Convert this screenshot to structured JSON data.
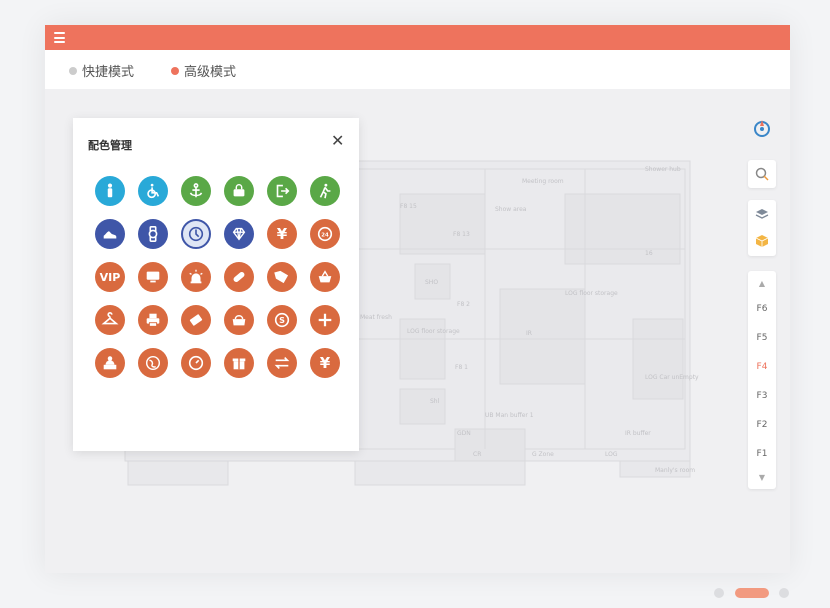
{
  "header": {
    "menu_icon": "menu-icon"
  },
  "modes": [
    {
      "label": "快捷模式",
      "dot_color": "#cccccc"
    },
    {
      "label": "高级模式",
      "dot_color": "#ee735d"
    }
  ],
  "floorplan_labels": [
    "F8 15",
    "F8 13",
    "Show area",
    "Meeting room",
    "Shower hub",
    "SHO",
    "F8 2",
    "LOG floor storage",
    "LOG floor storage",
    "F8 1",
    "Shl",
    "UB Man buffer 1",
    "IR",
    "LOG Car unEmpty",
    "IR buffer",
    "GDN",
    "CR",
    "G Zone",
    "LOG",
    "Manly's room",
    "Meat fresh",
    "16"
  ],
  "panel": {
    "title": "配色管理",
    "close_icon": "close-icon",
    "icons": [
      {
        "name": "person-icon",
        "color": "#29a9d8"
      },
      {
        "name": "wheelchair-icon",
        "color": "#29a9d8"
      },
      {
        "name": "anchor-icon",
        "color": "#5aa847"
      },
      {
        "name": "basket-icon",
        "color": "#5aa847"
      },
      {
        "name": "exit-icon",
        "color": "#5aa847"
      },
      {
        "name": "walking-icon",
        "color": "#5aa847"
      },
      {
        "name": "shoe-icon",
        "color": "#3f56a8"
      },
      {
        "name": "watch-icon",
        "color": "#3f56a8"
      },
      {
        "name": "clock-icon",
        "color": "#3f56a8"
      },
      {
        "name": "diamond-icon",
        "color": "#3f56a8"
      },
      {
        "name": "yen-icon",
        "color": "#d96a3f"
      },
      {
        "name": "phone-24-icon",
        "color": "#d96a3f"
      },
      {
        "name": "vip-icon",
        "color": "#d96a3f",
        "text": "VIP"
      },
      {
        "name": "monitor-icon",
        "color": "#d96a3f"
      },
      {
        "name": "alarm-icon",
        "color": "#d96a3f"
      },
      {
        "name": "pill-icon",
        "color": "#d96a3f"
      },
      {
        "name": "tag-icon",
        "color": "#d96a3f"
      },
      {
        "name": "shopping-basket-icon",
        "color": "#d96a3f"
      },
      {
        "name": "hanger-icon",
        "color": "#d96a3f"
      },
      {
        "name": "printer-icon",
        "color": "#d96a3f"
      },
      {
        "name": "ticket-icon",
        "color": "#d96a3f"
      },
      {
        "name": "bag-icon",
        "color": "#d96a3f"
      },
      {
        "name": "exchange-s-icon",
        "color": "#d96a3f"
      },
      {
        "name": "plus-icon",
        "color": "#d96a3f"
      },
      {
        "name": "service-desk-icon",
        "color": "#d96a3f"
      },
      {
        "name": "globe-icon",
        "color": "#d96a3f"
      },
      {
        "name": "speedometer-icon",
        "color": "#d96a3f"
      },
      {
        "name": "gift-icon",
        "color": "#d96a3f"
      },
      {
        "name": "transfer-icon",
        "color": "#d96a3f"
      },
      {
        "name": "yen-circle-icon",
        "color": "#d96a3f"
      }
    ]
  },
  "toolbar": [
    {
      "name": "compass-icon"
    },
    {
      "name": "zoom-icon"
    },
    {
      "name": "layers-icon"
    },
    {
      "name": "cube-icon"
    }
  ],
  "floors": {
    "items": [
      "F6",
      "F5",
      "F4",
      "F3",
      "F2",
      "F1"
    ],
    "active": "F4",
    "active_color": "#ee735d",
    "up_icon": "chevron-up-icon",
    "down_icon": "chevron-down-icon"
  }
}
